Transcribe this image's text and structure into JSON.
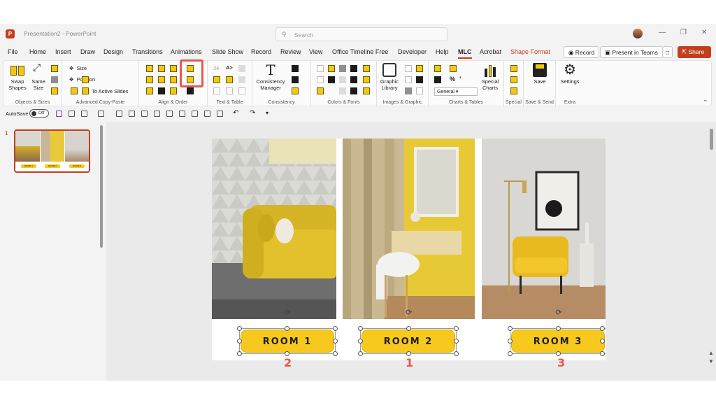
{
  "titlebar": {
    "doc_title": "Presentation2 - PowerPoint",
    "search_placeholder": "Search"
  },
  "tabs": [
    "File",
    "Home",
    "Insert",
    "Draw",
    "Design",
    "Transitions",
    "Animations",
    "Slide Show",
    "Record",
    "Review",
    "View",
    "Office Timeline Free",
    "Developer",
    "Help",
    "MLC",
    "Acrobat",
    "Shape Format"
  ],
  "active_tab": "MLC",
  "actions": {
    "record": "Record",
    "present_teams": "Present in Teams",
    "share": "Share"
  },
  "ribbon": {
    "objects_sizes": {
      "label": "Objects & Sizes",
      "swap_shapes": "Swap Shapes",
      "same_size": "Same Size"
    },
    "advanced_copy_paste": {
      "label": "Advanced Copy-Paste",
      "size": "Size",
      "position": "Position",
      "to_active_slides": "To Active Slides"
    },
    "align_order": {
      "label": "Align & Order"
    },
    "text_table": {
      "label": "Text & Table",
      "font_size": "24"
    },
    "consistency": {
      "label": "Consistency",
      "manager": "Consistency Manager"
    },
    "colors_fonts": {
      "label": "Colors & Fonts"
    },
    "images_graphic": {
      "label": "Images & Graphic",
      "graphic_library": "Graphic Library"
    },
    "charts_tables": {
      "label": "Charts & Tables",
      "number_format": "General",
      "special_charts": "Special Charts"
    },
    "special": {
      "label": "Special"
    },
    "save_send": {
      "label": "Save & Send",
      "save": "Save"
    },
    "extra": {
      "label": "Extra",
      "settings": "Settings"
    }
  },
  "qat": {
    "autosave": "AutoSave",
    "autosave_state": "Off"
  },
  "thumbnails": {
    "slide_number": "1",
    "labels": [
      "ROOM 1",
      "ROOM 2",
      "ROOM 3"
    ]
  },
  "slide": {
    "buttons": [
      "ROOM 1",
      "ROOM 2",
      "ROOM 3"
    ],
    "selection_order": [
      "2",
      "1",
      "3"
    ]
  },
  "colors": {
    "accent": "#c43e1c",
    "room_button": "#f7c91f",
    "annotation": "#e8584d"
  }
}
